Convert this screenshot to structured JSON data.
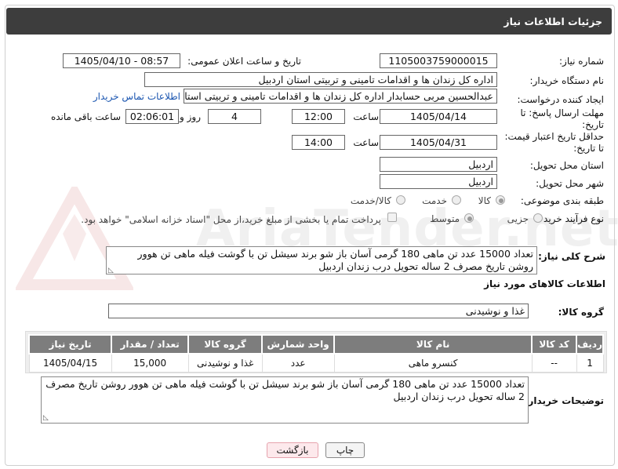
{
  "header": {
    "title": "جزئیات اطلاعات نیاز"
  },
  "form": {
    "need_number": {
      "label": "شماره نیاز:",
      "value": "1105003759000015"
    },
    "announce_datetime": {
      "label": "تاریخ و ساعت اعلان عمومی:",
      "value": "1405/04/10 - 08:57"
    },
    "buyer_org": {
      "label": "نام دستگاه خریدار:",
      "value": "اداره کل زندان ها و اقدامات تامینی و تربیتی استان اردبیل"
    },
    "requester": {
      "label": "ایجاد کننده درخواست:",
      "value": "عبدالحسین مربی حسابدار اداره کل زندان ها و اقدامات تامینی و تربیتی استان اردبیل",
      "contact_link": "اطلاعات تماس خریدار"
    },
    "reply_deadline": {
      "label_line1": "مهلت ارسال پاسخ: تا",
      "label_line2": "تاریخ:",
      "date": "1405/04/14",
      "time_label": "ساعت",
      "time": "12:00",
      "days": "4",
      "days_label": "روز و",
      "remaining": "02:06:01",
      "remaining_label": "ساعت باقی مانده"
    },
    "price_validity": {
      "label_line1": "حداقل تاریخ اعتبار قیمت:",
      "label_line2": "تا تاریخ:",
      "date": "1405/04/31",
      "time_label": "ساعت",
      "time": "14:00"
    },
    "delivery_province": {
      "label": "استان محل تحویل:",
      "value": "اردبیل"
    },
    "delivery_city": {
      "label": "شهر محل تحویل:",
      "value": "اردبیل"
    },
    "category": {
      "label": "طبقه بندی موضوعی:",
      "options": [
        "کالا",
        "خدمت",
        "کالا/خدمت"
      ],
      "selected": "کالا"
    },
    "purchase_type": {
      "label": "نوع فرآیند خرید :",
      "options": [
        "جزیی",
        "متوسط"
      ],
      "selected": "متوسط",
      "payment_note": "پرداخت تمام یا بخشی از مبلغ خرید،از محل \"اسناد خزانه اسلامی\" خواهد بود."
    }
  },
  "description": {
    "label": "شرح کلی نیاز:",
    "value": "تعداد 15000 عدد تن ماهی 180 گرمی آسان باز شو برند سیشل تن با گوشت فیله ماهی تن هوور روشن تاریخ مصرف 2 ساله تحویل درب زندان اردبیل"
  },
  "goods": {
    "section_title": "اطلاعات کالاهای مورد نیاز",
    "group_label": "گروه کالا:",
    "group_value": "غذا و نوشیدنی",
    "table": {
      "headers": [
        "ردیف",
        "کد کالا",
        "نام کالا",
        "واحد شمارش",
        "گروه کالا",
        "تعداد / مقدار",
        "تاریخ نیاز"
      ],
      "rows": [
        [
          "1",
          "--",
          "کنسرو ماهی",
          "عدد",
          "غذا و نوشیدنی",
          "15,000",
          "1405/04/15"
        ]
      ]
    }
  },
  "buyer_notes": {
    "label": "توضیحات خریدار:",
    "value": "تعداد 15000 عدد تن ماهی 180 گرمی آسان باز شو برند سیشل تن با گوشت فیله ماهی تن هوور روشن تاریخ مصرف 2 ساله تحویل درب زندان اردبیل"
  },
  "buttons": {
    "print": "چاپ",
    "back": "بازگشت"
  },
  "watermark": "AriaTender.net",
  "colors": {
    "header_bg": "#3d3d3d",
    "table_header_bg": "#7d7d7d",
    "link": "#1a55b0",
    "back_button_bg": "#fde9ec"
  }
}
